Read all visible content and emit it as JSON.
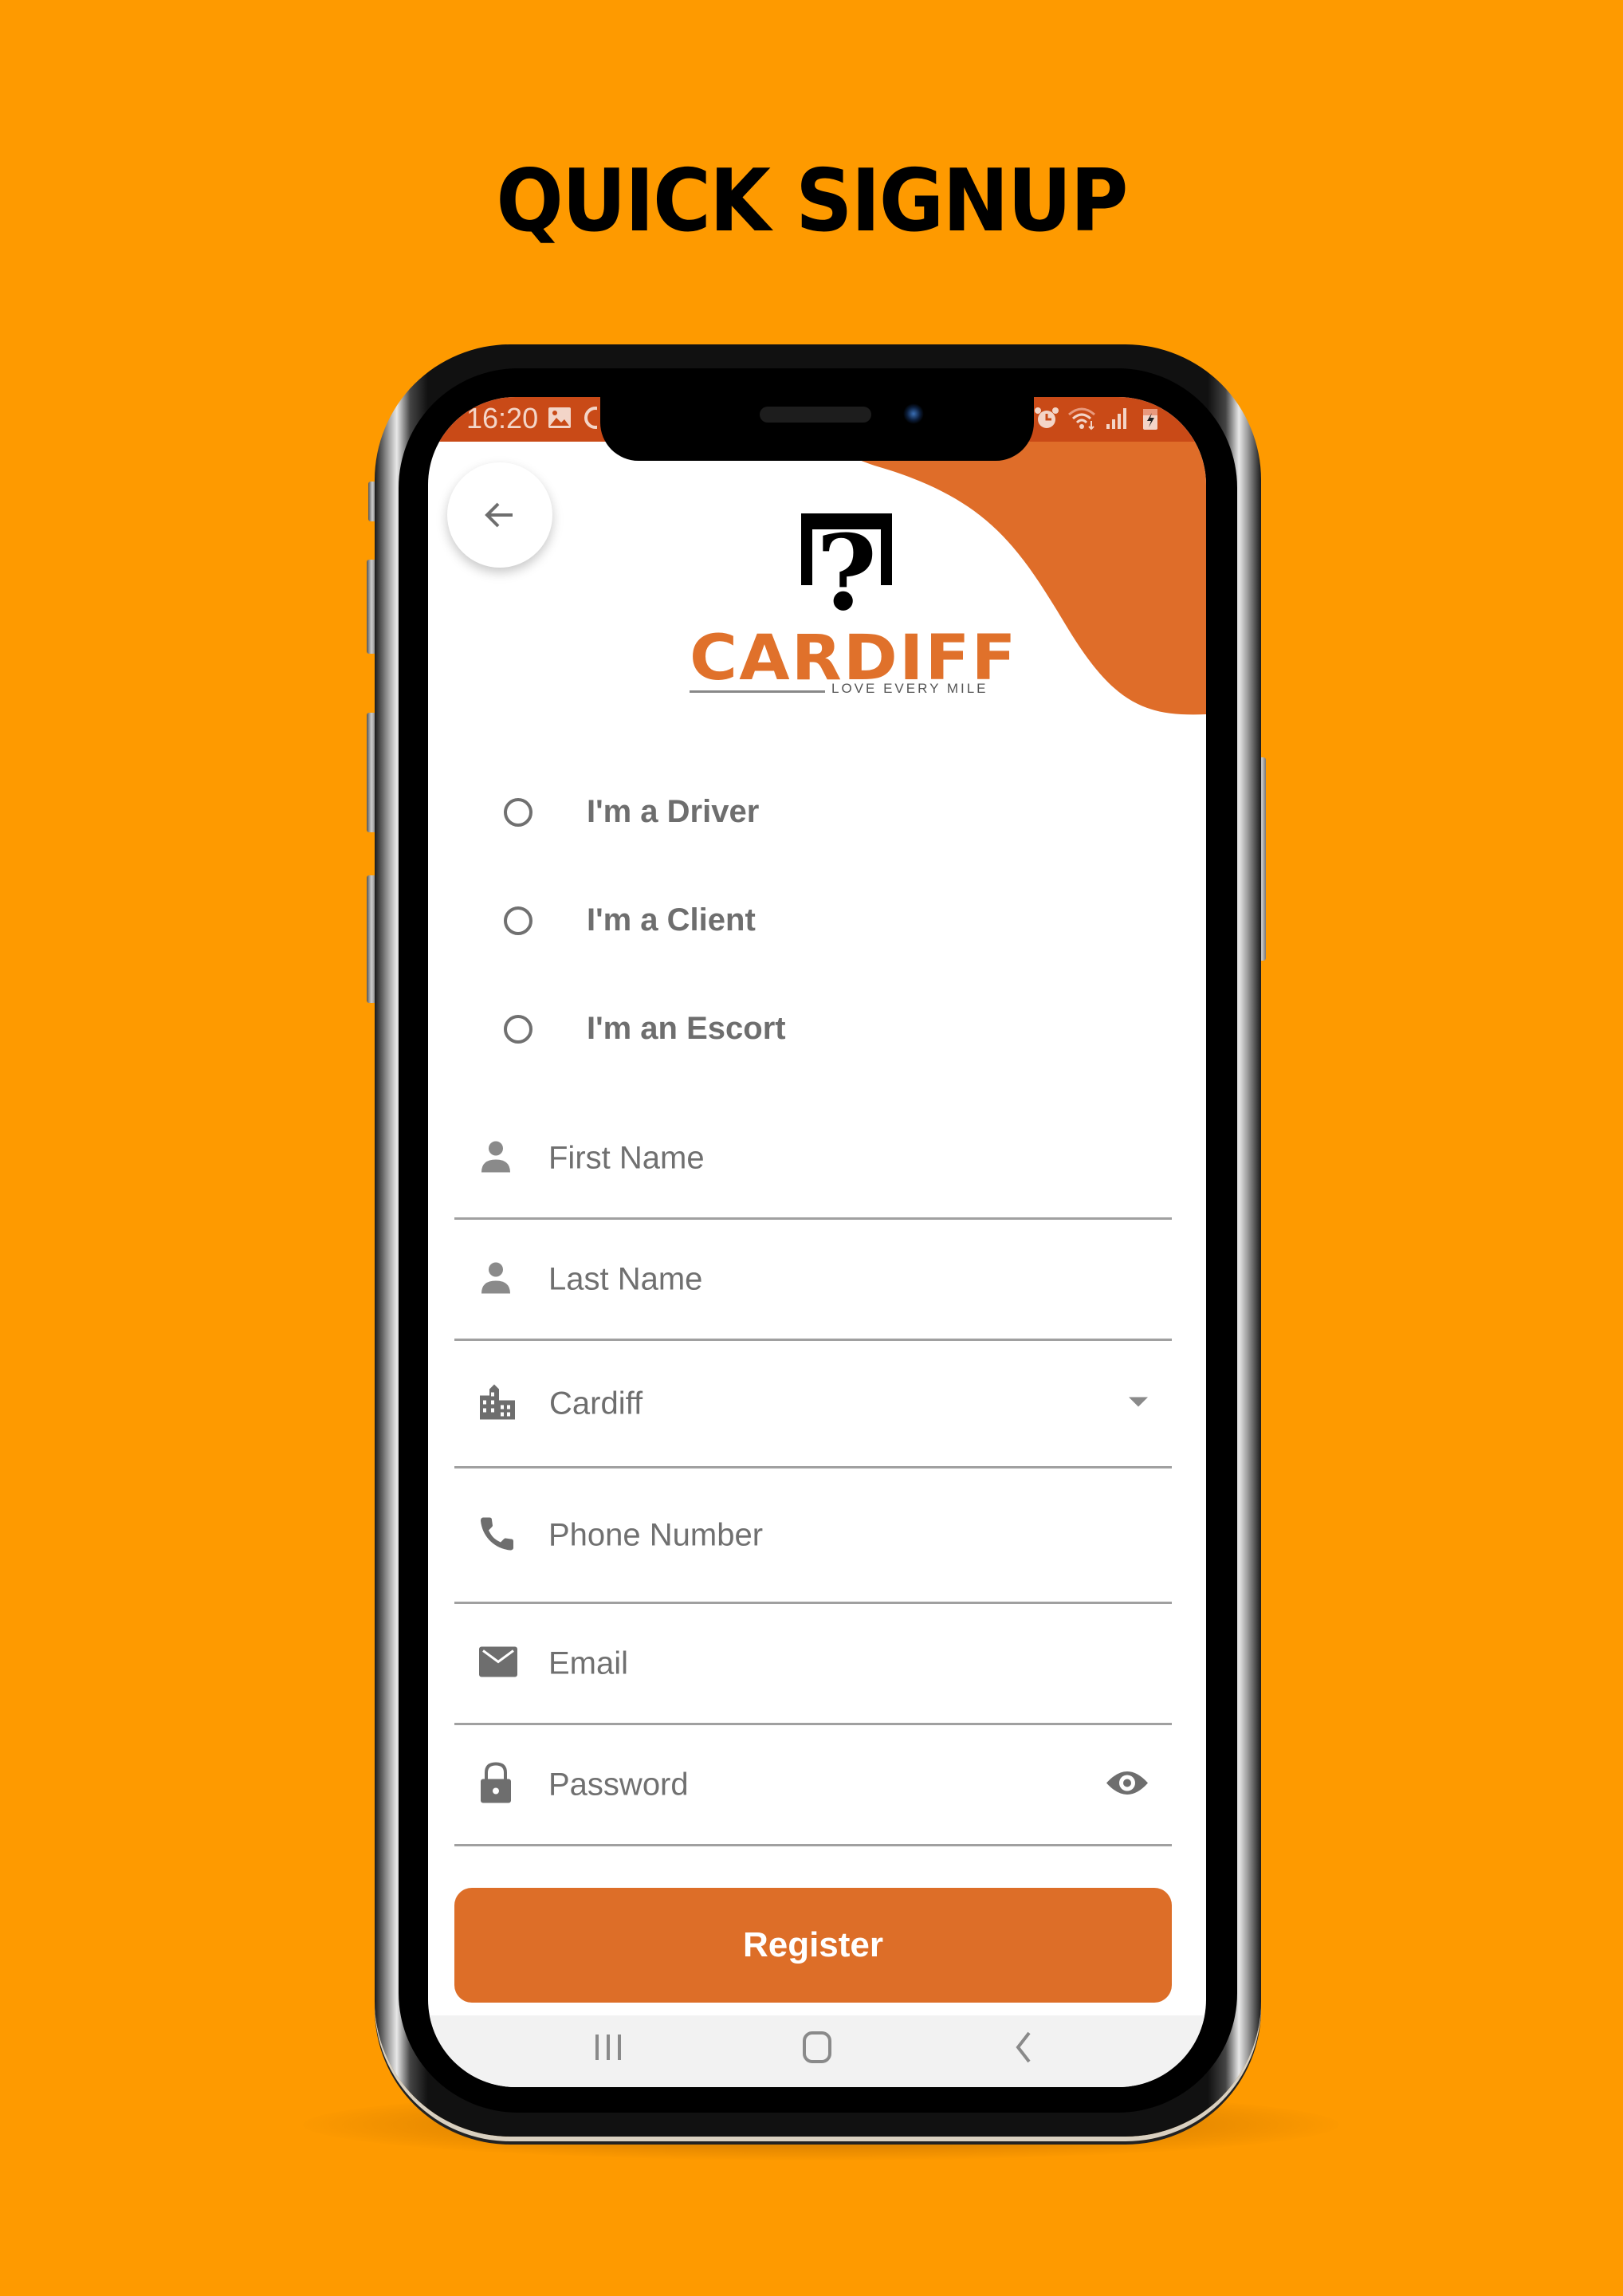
{
  "page": {
    "title": "QUICK SIGNUP",
    "background_color": "#FE9A00"
  },
  "status_bar": {
    "time": "16:20",
    "left_icons": [
      "image-icon",
      "notification-icon"
    ],
    "right_icons": [
      "alarm-icon",
      "wifi-icon",
      "signal-icon",
      "battery-charging-icon"
    ],
    "color": "#C94A17"
  },
  "app": {
    "accent_color": "#DD6E28",
    "back_button": {
      "icon": "arrow-left-icon"
    },
    "logo": {
      "broken_image_glyph": "?",
      "brand": "CARDIFF",
      "tagline": "LOVE EVERY MILE"
    },
    "roles": [
      {
        "label": "I'm a Driver",
        "selected": false
      },
      {
        "label": "I'm a Client",
        "selected": false
      },
      {
        "label": "I'm an Escort",
        "selected": false
      }
    ],
    "fields": {
      "first_name": {
        "placeholder": "First Name",
        "icon": "person-icon",
        "value": ""
      },
      "last_name": {
        "placeholder": "Last Name",
        "icon": "person-icon",
        "value": ""
      },
      "city": {
        "value": "Cardiff",
        "icon": "city-icon"
      },
      "phone": {
        "placeholder": "Phone Number",
        "icon": "phone-icon",
        "value": ""
      },
      "email": {
        "placeholder": "Email",
        "icon": "email-icon",
        "value": ""
      },
      "password": {
        "placeholder": "Password",
        "icon": "lock-icon",
        "value": ""
      }
    },
    "register_label": "Register"
  },
  "nav_bar": {
    "items": [
      "recent-apps",
      "home",
      "back"
    ]
  }
}
